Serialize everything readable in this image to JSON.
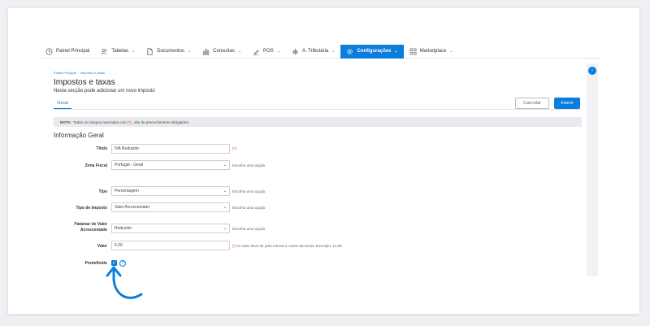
{
  "nav": {
    "items": [
      {
        "label": "Painel Principal",
        "icon": "clock-icon",
        "dropdown": false,
        "active": false
      },
      {
        "label": "Tabelas",
        "icon": "users-icon",
        "dropdown": true,
        "active": false
      },
      {
        "label": "Documentos",
        "icon": "document-icon",
        "dropdown": true,
        "active": false
      },
      {
        "label": "Consultas",
        "icon": "bar-chart-icon",
        "dropdown": true,
        "active": false
      },
      {
        "label": "POS",
        "icon": "pen-icon",
        "dropdown": true,
        "active": false
      },
      {
        "label": "A. Tributária",
        "icon": "tax-icon",
        "dropdown": true,
        "active": false
      },
      {
        "label": "Configurações",
        "icon": "gear-icon",
        "dropdown": true,
        "active": true
      },
      {
        "label": "Marketplace",
        "icon": "grid-icon",
        "dropdown": true,
        "active": false
      }
    ],
    "chevron": "⌄",
    "active_color": "#0b7ddc"
  },
  "breadcrumb": {
    "home": "Painel Principal",
    "sep": "/",
    "current": "Impostos e taxas"
  },
  "page": {
    "title": "Impostos e taxas",
    "subtitle": "Nesta secção pode adicionar um novo imposto",
    "tab": "Geral",
    "cancel_label": "Cancelar",
    "insert_label": "Inserir"
  },
  "note": {
    "prefix": "NOTA:",
    "text_before": "Todos os campos marcados com",
    "req": "(*)",
    "text_after": ", são de preenchimento obrigatório"
  },
  "section": {
    "title": "Informação Geral"
  },
  "form": {
    "titulo": {
      "label": "Título",
      "value": "IVA Reduzido",
      "req": "(*)"
    },
    "zona": {
      "label": "Zona Fiscal",
      "value": "Portugal - Geral",
      "hint": "Escolha uma opção"
    },
    "tipo": {
      "label": "Tipo",
      "value": "Percentagem",
      "hint": "Escolha uma opção"
    },
    "tipo_imposto": {
      "label": "Tipo de Imposto",
      "value": "Valor Acrescentado",
      "hint": "Escolha uma opção"
    },
    "patamar": {
      "label_line1": "Patamar de Valor",
      "label_line2": "Acrescentado",
      "value": "Reduzido",
      "hint": "Escolha uma opção"
    },
    "valor": {
      "label": "Valor",
      "value": "6.00",
      "req": "(*)",
      "hint": "O valor deve ter pelo menos 2 casas decimais. Exemplo: 12,00"
    },
    "predefinido": {
      "label": "Predefinido",
      "checked": true,
      "help": "?"
    }
  },
  "colors": {
    "accent": "#0b7ddc",
    "required": "#e22222"
  }
}
